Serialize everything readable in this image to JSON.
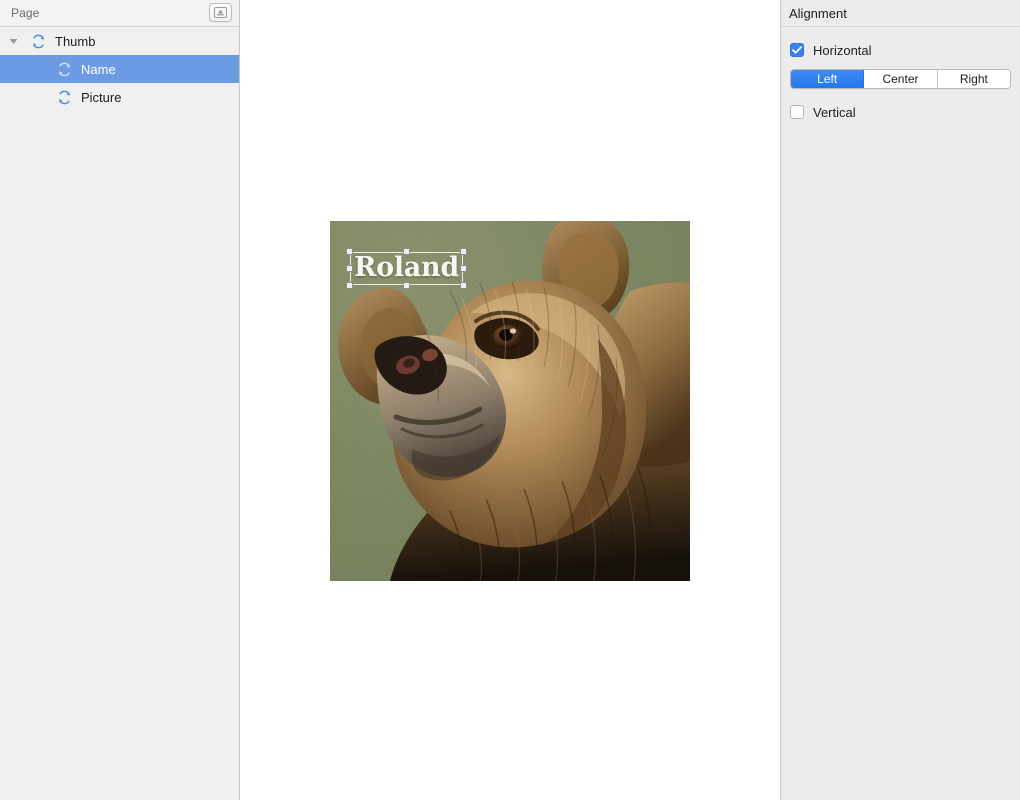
{
  "left_panel": {
    "header": {
      "title": "Page",
      "button_icon": "export-up-icon"
    },
    "tree": [
      {
        "label": "Thumb",
        "icon": "sync-circle-icon",
        "depth": 0,
        "selected": false,
        "expanded": true,
        "disclosure": "chevron-down-icon"
      },
      {
        "label": "Name",
        "icon": "sync-circle-icon",
        "depth": 1,
        "selected": true,
        "expanded": false,
        "disclosure": ""
      },
      {
        "label": "Picture",
        "icon": "sync-circle-icon",
        "depth": 1,
        "selected": false,
        "expanded": false,
        "disclosure": ""
      }
    ]
  },
  "canvas": {
    "artboard": {
      "text_element": {
        "value": "Roland",
        "selected": true,
        "color": "#f6f6f2"
      },
      "image_element": {
        "subject": "brown-bear-photo",
        "background_color": "#7d8761"
      }
    }
  },
  "inspector": {
    "title": "Alignment",
    "horizontal": {
      "label": "Horizontal",
      "checked": true,
      "options": [
        "Left",
        "Center",
        "Right"
      ],
      "selected": "Left"
    },
    "vertical": {
      "label": "Vertical",
      "checked": false
    }
  },
  "colors": {
    "accent": "#3b82f0",
    "selection_row": "#6b9be2",
    "panel_bg": "#f0f0f0",
    "inspector_bg": "#ececec",
    "icon_blue": "#4a90e2"
  }
}
